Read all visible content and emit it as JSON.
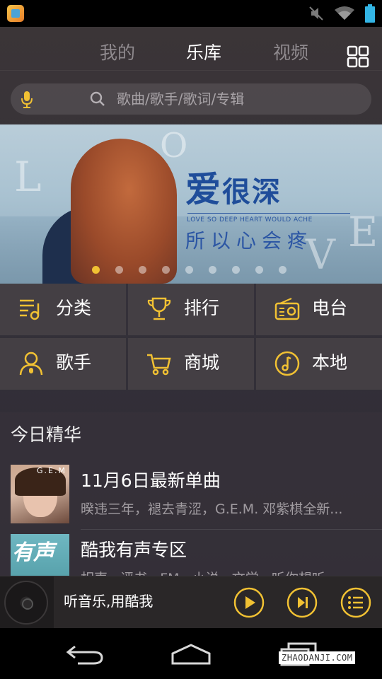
{
  "status_bar": {
    "icons": [
      "app-icon",
      "mute-icon",
      "wifi-icon",
      "battery-icon"
    ]
  },
  "tabs": [
    {
      "label": "我的",
      "active": false
    },
    {
      "label": "乐库",
      "active": true
    },
    {
      "label": "视频",
      "active": false
    }
  ],
  "search": {
    "placeholder": "歌曲/歌手/歌词/专辑"
  },
  "banner": {
    "title_main": "爱",
    "title_rest": "很深",
    "subtitle": "LOVE SO DEEP HEART WOULD ACHE",
    "title_line2": "所以心会疼",
    "letters": [
      "L",
      "O",
      "V",
      "E"
    ],
    "slide_count": 9,
    "active_slide": 1
  },
  "categories": [
    {
      "label": "分类",
      "icon": "category-list-icon"
    },
    {
      "label": "排行",
      "icon": "trophy-icon"
    },
    {
      "label": "电台",
      "icon": "radio-icon"
    },
    {
      "label": "歌手",
      "icon": "singer-icon"
    },
    {
      "label": "商城",
      "icon": "cart-icon"
    },
    {
      "label": "本地",
      "icon": "music-note-icon"
    }
  ],
  "today": {
    "title": "今日精华",
    "items": [
      {
        "title": "11月6日最新单曲",
        "subtitle": "暌违三年，褪去青涩，G.E.M. 邓紫棋全新...",
        "cover_text": "G.E.M"
      },
      {
        "title": "酷我有声专区",
        "subtitle": "相声 · 评书 · FM · 小说 · 文学 · 听你想听",
        "cover_text": "有声"
      }
    ]
  },
  "player": {
    "now_playing": "听音乐,用酷我"
  },
  "watermark": "ZHAODANJI.COM",
  "colors": {
    "accent": "#f1c133",
    "text": "#ffffff",
    "muted": "#a09ba0"
  }
}
